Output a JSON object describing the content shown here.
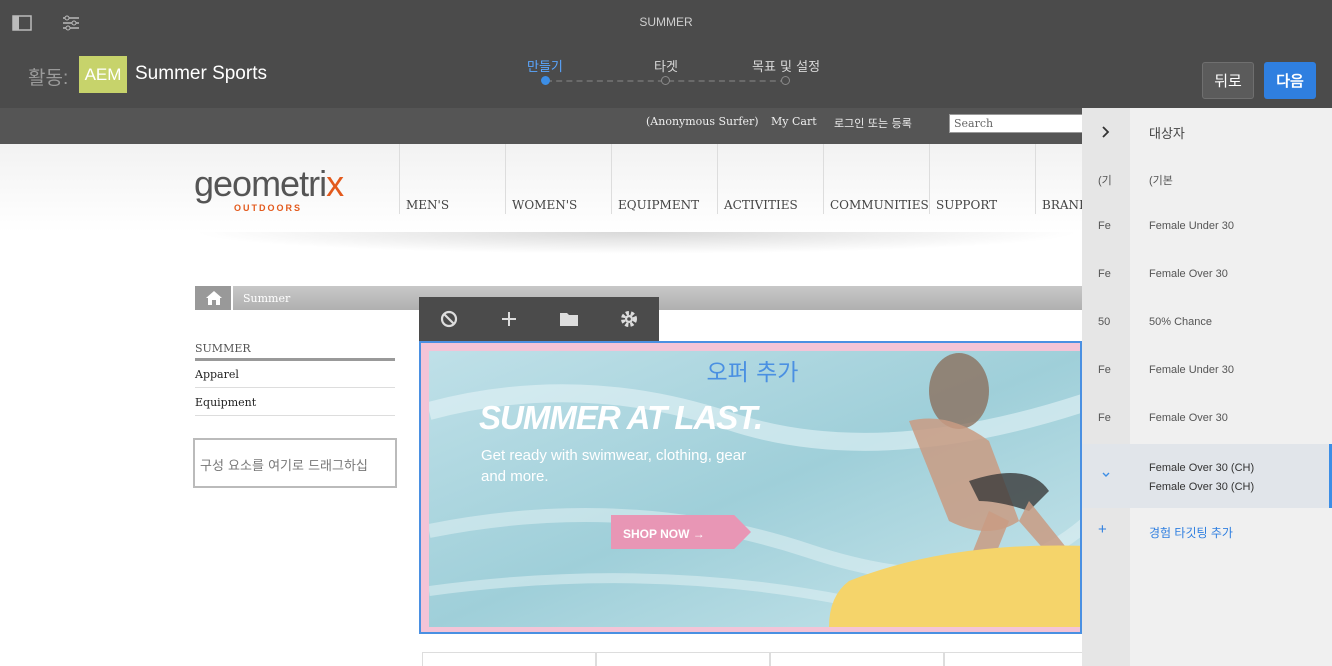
{
  "topbar": {
    "title": "SUMMER",
    "activity_label": "활동:",
    "brand_badge": "AEM",
    "activity_name": "Summer Sports",
    "steps": [
      "만들기",
      "타겟",
      "목표 및 설정"
    ],
    "back_label": "뒤로",
    "next_label": "다음",
    "icons": [
      "sidepanel-icon",
      "settings-sliders-icon"
    ]
  },
  "page": {
    "strip_links": [
      "(Anonymous Surfer)",
      "My Cart",
      "로그인 또는 등록"
    ],
    "search_placeholder": "Search",
    "logo": {
      "main": "geometri",
      "x": "x",
      "sub": "OUTDOORS"
    },
    "nav": [
      "MEN'S",
      "WOMEN'S",
      "EQUIPMENT",
      "ACTIVITIES",
      "COMMUNITIES",
      "SUPPORT",
      "BRAND"
    ],
    "breadcrumb": "Summer",
    "sidenav": {
      "heading": "SUMMER",
      "items": [
        "Apparel",
        "Equipment"
      ]
    },
    "dropzone": "구성 요소를 여기로 드래그하십",
    "toolbar_icons": [
      "disable-icon",
      "add-icon",
      "folder-icon",
      "gear-icon"
    ],
    "offer_label": "오퍼 추가",
    "hero": {
      "title": "SUMMER AT LAST.",
      "subtitle": "Get ready with swimwear, clothing, gear and more.",
      "cta": "SHOP NOW →"
    }
  },
  "panel": {
    "header": "대상자",
    "rows": [
      {
        "abbr": "(기",
        "label": "(기본"
      },
      {
        "abbr": "Fe",
        "label": "Female Under 30"
      },
      {
        "abbr": "Fe",
        "label": "Female Over 30"
      },
      {
        "abbr": "50",
        "label": "50% Chance"
      },
      {
        "abbr": "Fe",
        "label": "Female Under 30"
      },
      {
        "abbr": "Fe",
        "label": "Female Over 30"
      }
    ],
    "selected": {
      "line1": "Female Over 30 (CH)",
      "line2": "Female Over 30 (CH)"
    },
    "add_label": "경험 타깃팅 추가"
  }
}
